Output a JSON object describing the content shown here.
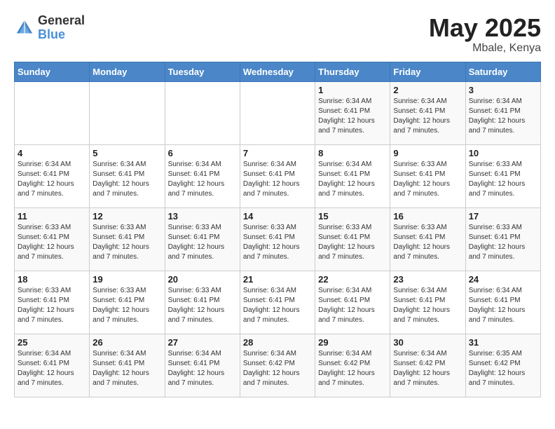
{
  "logo": {
    "general": "General",
    "blue": "Blue"
  },
  "title": "May 2025",
  "location": "Mbale, Kenya",
  "days_of_week": [
    "Sunday",
    "Monday",
    "Tuesday",
    "Wednesday",
    "Thursday",
    "Friday",
    "Saturday"
  ],
  "weeks": [
    [
      {
        "day": "",
        "info": ""
      },
      {
        "day": "",
        "info": ""
      },
      {
        "day": "",
        "info": ""
      },
      {
        "day": "",
        "info": ""
      },
      {
        "day": "1",
        "info": "Sunrise: 6:34 AM\nSunset: 6:41 PM\nDaylight: 12 hours\nand 7 minutes."
      },
      {
        "day": "2",
        "info": "Sunrise: 6:34 AM\nSunset: 6:41 PM\nDaylight: 12 hours\nand 7 minutes."
      },
      {
        "day": "3",
        "info": "Sunrise: 6:34 AM\nSunset: 6:41 PM\nDaylight: 12 hours\nand 7 minutes."
      }
    ],
    [
      {
        "day": "4",
        "info": "Sunrise: 6:34 AM\nSunset: 6:41 PM\nDaylight: 12 hours\nand 7 minutes."
      },
      {
        "day": "5",
        "info": "Sunrise: 6:34 AM\nSunset: 6:41 PM\nDaylight: 12 hours\nand 7 minutes."
      },
      {
        "day": "6",
        "info": "Sunrise: 6:34 AM\nSunset: 6:41 PM\nDaylight: 12 hours\nand 7 minutes."
      },
      {
        "day": "7",
        "info": "Sunrise: 6:34 AM\nSunset: 6:41 PM\nDaylight: 12 hours\nand 7 minutes."
      },
      {
        "day": "8",
        "info": "Sunrise: 6:34 AM\nSunset: 6:41 PM\nDaylight: 12 hours\nand 7 minutes."
      },
      {
        "day": "9",
        "info": "Sunrise: 6:33 AM\nSunset: 6:41 PM\nDaylight: 12 hours\nand 7 minutes."
      },
      {
        "day": "10",
        "info": "Sunrise: 6:33 AM\nSunset: 6:41 PM\nDaylight: 12 hours\nand 7 minutes."
      }
    ],
    [
      {
        "day": "11",
        "info": "Sunrise: 6:33 AM\nSunset: 6:41 PM\nDaylight: 12 hours\nand 7 minutes."
      },
      {
        "day": "12",
        "info": "Sunrise: 6:33 AM\nSunset: 6:41 PM\nDaylight: 12 hours\nand 7 minutes."
      },
      {
        "day": "13",
        "info": "Sunrise: 6:33 AM\nSunset: 6:41 PM\nDaylight: 12 hours\nand 7 minutes."
      },
      {
        "day": "14",
        "info": "Sunrise: 6:33 AM\nSunset: 6:41 PM\nDaylight: 12 hours\nand 7 minutes."
      },
      {
        "day": "15",
        "info": "Sunrise: 6:33 AM\nSunset: 6:41 PM\nDaylight: 12 hours\nand 7 minutes."
      },
      {
        "day": "16",
        "info": "Sunrise: 6:33 AM\nSunset: 6:41 PM\nDaylight: 12 hours\nand 7 minutes."
      },
      {
        "day": "17",
        "info": "Sunrise: 6:33 AM\nSunset: 6:41 PM\nDaylight: 12 hours\nand 7 minutes."
      }
    ],
    [
      {
        "day": "18",
        "info": "Sunrise: 6:33 AM\nSunset: 6:41 PM\nDaylight: 12 hours\nand 7 minutes."
      },
      {
        "day": "19",
        "info": "Sunrise: 6:33 AM\nSunset: 6:41 PM\nDaylight: 12 hours\nand 7 minutes."
      },
      {
        "day": "20",
        "info": "Sunrise: 6:33 AM\nSunset: 6:41 PM\nDaylight: 12 hours\nand 7 minutes."
      },
      {
        "day": "21",
        "info": "Sunrise: 6:34 AM\nSunset: 6:41 PM\nDaylight: 12 hours\nand 7 minutes."
      },
      {
        "day": "22",
        "info": "Sunrise: 6:34 AM\nSunset: 6:41 PM\nDaylight: 12 hours\nand 7 minutes."
      },
      {
        "day": "23",
        "info": "Sunrise: 6:34 AM\nSunset: 6:41 PM\nDaylight: 12 hours\nand 7 minutes."
      },
      {
        "day": "24",
        "info": "Sunrise: 6:34 AM\nSunset: 6:41 PM\nDaylight: 12 hours\nand 7 minutes."
      }
    ],
    [
      {
        "day": "25",
        "info": "Sunrise: 6:34 AM\nSunset: 6:41 PM\nDaylight: 12 hours\nand 7 minutes."
      },
      {
        "day": "26",
        "info": "Sunrise: 6:34 AM\nSunset: 6:41 PM\nDaylight: 12 hours\nand 7 minutes."
      },
      {
        "day": "27",
        "info": "Sunrise: 6:34 AM\nSunset: 6:41 PM\nDaylight: 12 hours\nand 7 minutes."
      },
      {
        "day": "28",
        "info": "Sunrise: 6:34 AM\nSunset: 6:42 PM\nDaylight: 12 hours\nand 7 minutes."
      },
      {
        "day": "29",
        "info": "Sunrise: 6:34 AM\nSunset: 6:42 PM\nDaylight: 12 hours\nand 7 minutes."
      },
      {
        "day": "30",
        "info": "Sunrise: 6:34 AM\nSunset: 6:42 PM\nDaylight: 12 hours\nand 7 minutes."
      },
      {
        "day": "31",
        "info": "Sunrise: 6:35 AM\nSunset: 6:42 PM\nDaylight: 12 hours\nand 7 minutes."
      }
    ]
  ]
}
